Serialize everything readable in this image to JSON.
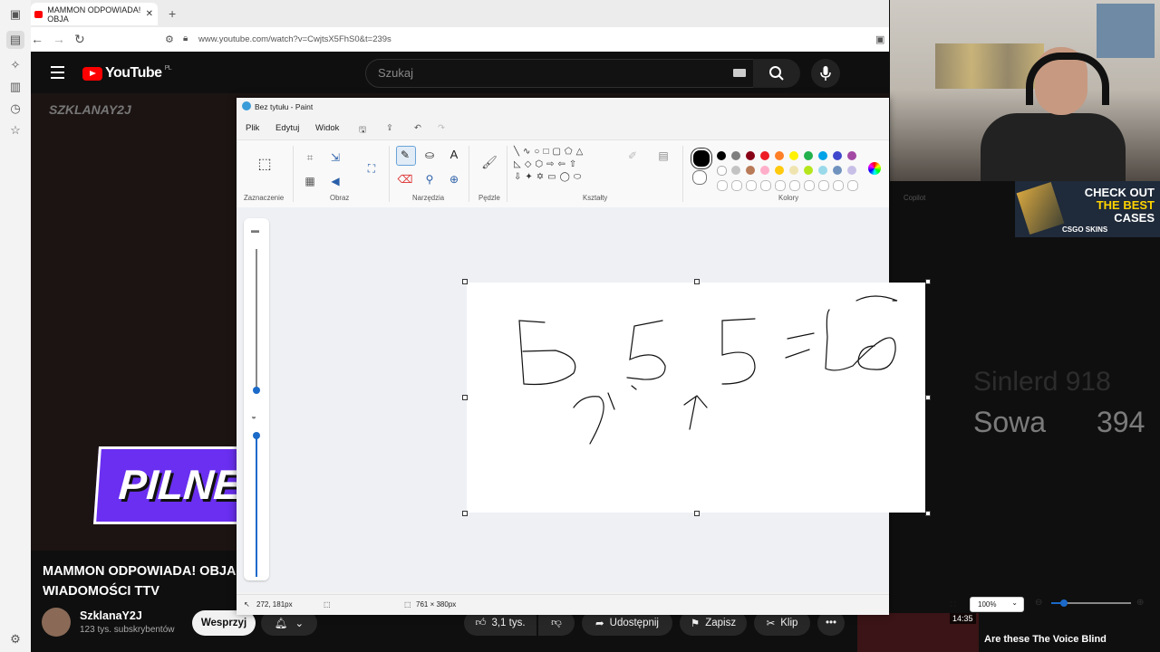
{
  "browser": {
    "tab_title": "MAMMON ODPOWIADA! OBJA",
    "tab_close": "✕",
    "new_tab": "+",
    "url": "www.youtube.com/watch?v=CwjtsX5FhS0&t=239s"
  },
  "youtube": {
    "logo_text": "YouTube",
    "region": "PL",
    "search_placeholder": "Szukaj",
    "video_title": "MAMMON ODPOWIADA! OBJA WIADOMOŚCI TTV",
    "channel_name": "SzklanaY2J",
    "subscribers": "123 tys. subskrybentów",
    "support_button": "Wesprzyj",
    "like_count": "3,1 tys.",
    "share_label": "Udostępnij",
    "save_label": "Zapisz",
    "clip_label": "Klip",
    "more_label": "•••",
    "watermark": "SZKLANAY2J",
    "pilne_text": "PILNE",
    "score_line1": "Sinlerd 918",
    "score_line2_name": "Sowa",
    "score_line2_value": "394",
    "rec_duration": "14:35",
    "rec_title": "Are these The Voice Blind"
  },
  "ad": {
    "line1": "CHECK OUT",
    "line2": "THE BEST",
    "line3": "CASES",
    "brand": "CSGO SKINS"
  },
  "paint": {
    "window_title": "Bez tytułu - Paint",
    "menus": [
      "Plik",
      "Edytuj",
      "Widok"
    ],
    "groups": {
      "selection": "Zaznaczenie",
      "image": "Obraz",
      "tools": "Narzędzia",
      "brushes": "Pędzle",
      "shapes": "Kształty",
      "colors": "Kolory",
      "copilot": "Copilot",
      "layers": "Warstwy"
    },
    "status": {
      "cursor": "272, 181px",
      "canvas_size": "761 × 380px",
      "zoom": "100%"
    },
    "palette_top": [
      "#000000",
      "#7f7f7f",
      "#880015",
      "#ed1c24",
      "#ff7f27",
      "#fff200",
      "#22b14c",
      "#00a2e8",
      "#3f48cc",
      "#a349a4"
    ],
    "palette_mid": [
      "#ffffff",
      "#c3c3c3",
      "#b97a57",
      "#ffaec9",
      "#ffc90e",
      "#efe4b0",
      "#b5e61d",
      "#99d9ea",
      "#7092be",
      "#c8bfe7"
    ]
  }
}
